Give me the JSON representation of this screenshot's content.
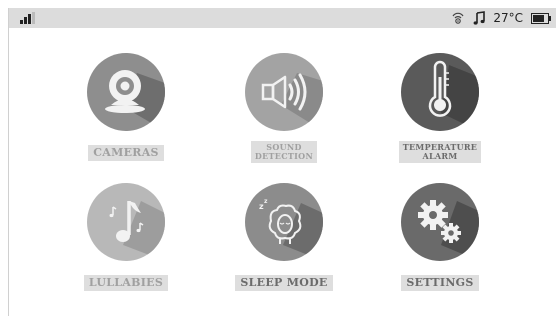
{
  "status_bar": {
    "signal_icon": "signal-bars-icon",
    "camera_wave_icon": "camera-signal-icon",
    "music_icon": "music-note-icon",
    "temperature": "27°C",
    "battery_icon": "battery-icon",
    "battery_level": 0.75
  },
  "tiles": [
    {
      "label": "CAMERAS",
      "icon": "camera-icon"
    },
    {
      "label": "SOUND\nDETECTION",
      "icon": "speaker-icon"
    },
    {
      "label": "TEMPERATURE\nALARM",
      "icon": "thermometer-icon"
    },
    {
      "label": "LULLABIES",
      "icon": "music-note-icon"
    },
    {
      "label": "SLEEP MODE",
      "icon": "sleeping-sheep-icon"
    },
    {
      "label": "SETTINGS",
      "icon": "gears-icon"
    }
  ],
  "colors": {
    "circle_light": "#b0b0b0",
    "circle_mid": "#8c8c8c",
    "circle_dark": "#5a5a5a",
    "status_bar": "#dcdcdc",
    "label_bg": "#dedede"
  }
}
